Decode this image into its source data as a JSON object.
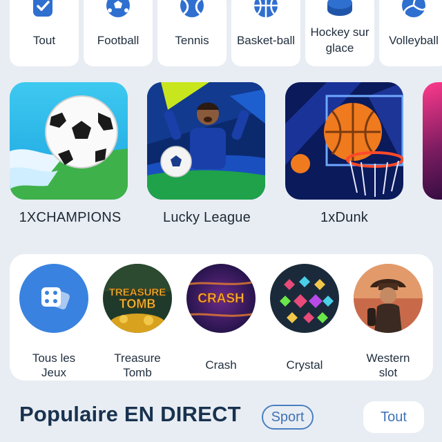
{
  "sports": [
    {
      "label": "Tout",
      "icon": "all-icon"
    },
    {
      "label": "Football",
      "icon": "football-icon"
    },
    {
      "label": "Tennis",
      "icon": "tennis-icon"
    },
    {
      "label": "Basket-ball",
      "icon": "basketball-icon"
    },
    {
      "label": "Hockey sur glace",
      "label_lines": [
        "Hockey sur",
        "glace"
      ],
      "icon": "hockey-puck-icon"
    },
    {
      "label": "Volleyball",
      "icon": "volleyball-icon"
    }
  ],
  "featured": [
    {
      "title": "1XCHAMPIONS"
    },
    {
      "title": "Lucky League"
    },
    {
      "title": "1xDunk"
    }
  ],
  "casino": [
    {
      "label_lines": [
        "Tous les",
        "Jeux"
      ],
      "icon": "dice-icon"
    },
    {
      "label_lines": [
        "Treasure",
        "Tomb"
      ],
      "logo_text": "TREASURE TOMB"
    },
    {
      "label_lines": [
        "Crash"
      ],
      "logo_text": "CRASH"
    },
    {
      "label_lines": [
        "Crystal"
      ]
    },
    {
      "label_lines": [
        "Western",
        "slot"
      ]
    }
  ],
  "popular": {
    "title": "Populaire EN DIRECT",
    "chip": "Sport",
    "all_button": "Tout"
  },
  "colors": {
    "accent": "#3f73b7",
    "icon_blue": "#2f6fd0",
    "background": "#e8edf3"
  }
}
